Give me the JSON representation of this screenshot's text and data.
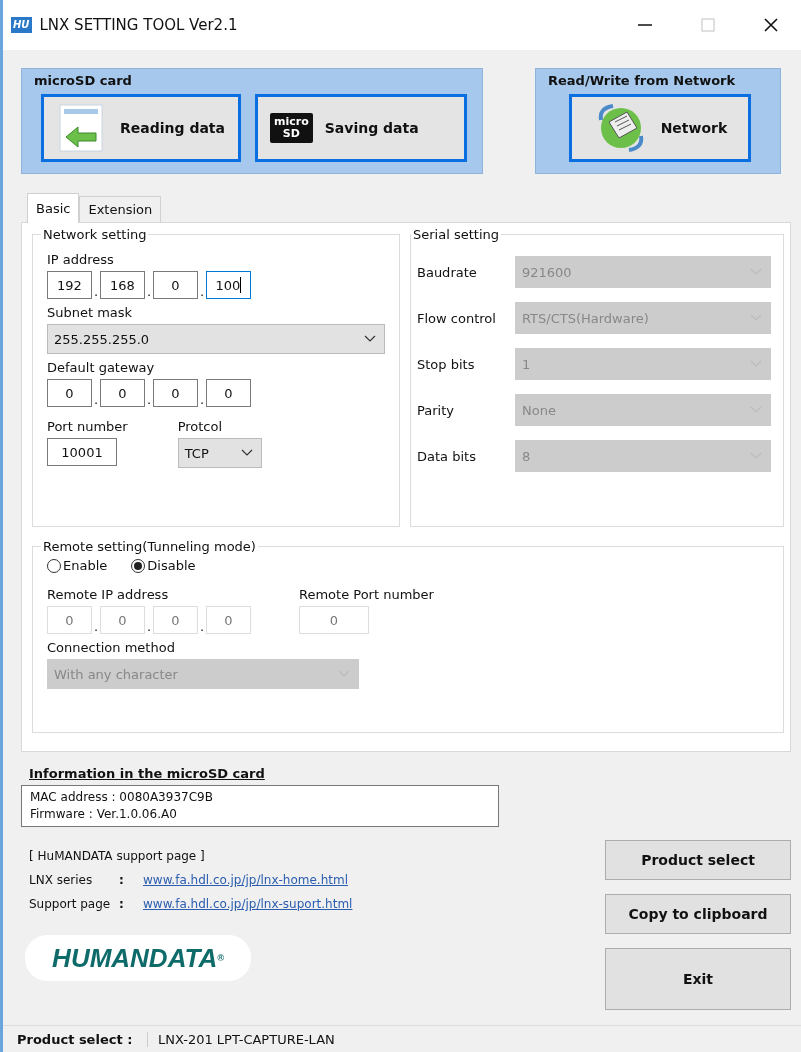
{
  "window": {
    "title": "LNX SETTING TOOL Ver2.1",
    "icon_text": "HU"
  },
  "microsd_panel": {
    "title": "microSD card",
    "buttons": [
      {
        "label": "Reading data",
        "kind": "read"
      },
      {
        "label": "Saving data",
        "kind": "sd",
        "icon_text": [
          "micro",
          "SD"
        ]
      }
    ]
  },
  "network_panel": {
    "title": "Read/Write from Network",
    "button": {
      "label": "Network",
      "kind": "network"
    }
  },
  "tabs": [
    {
      "label": "Basic",
      "selected": true
    },
    {
      "label": "Extension",
      "selected": false
    }
  ],
  "network_setting": {
    "title": "Network setting",
    "ip_label": "IP address",
    "ip": [
      {
        "value": "192",
        "focused": false
      },
      {
        "value": "168",
        "focused": false
      },
      {
        "value": "0",
        "focused": false
      },
      {
        "value": "100",
        "focused": true
      }
    ],
    "separator": ".",
    "subnet_label": "Subnet mask",
    "subnet": "255.255.255.0",
    "gateway_label": "Default gateway",
    "gateway": [
      "0",
      "0",
      "0",
      "0"
    ],
    "port_label": "Port number",
    "port": "10001",
    "protocol_label": "Protcol",
    "protocol": "TCP"
  },
  "serial_setting": {
    "title": "Serial setting",
    "rows": [
      {
        "label": "Baudrate",
        "value": "921600",
        "disabled": true
      },
      {
        "label": "Flow control",
        "value": "RTS/CTS(Hardware)",
        "disabled": true
      },
      {
        "label": "Stop bits",
        "value": "1",
        "disabled": true
      },
      {
        "label": "Parity",
        "value": "None",
        "disabled": true
      },
      {
        "label": "Data bits",
        "value": "8",
        "disabled": true
      }
    ]
  },
  "remote_setting": {
    "title": "Remote setting(Tunneling mode)",
    "options": [
      {
        "label": "Enable",
        "selected": false
      },
      {
        "label": "Disable",
        "selected": true
      }
    ],
    "ip_label": "Remote IP address",
    "ip": [
      "0",
      "0",
      "0",
      "0"
    ],
    "separator": ".",
    "port_label": "Remote Port number",
    "port": "0",
    "method_label": "Connection method",
    "method": "With any character",
    "disabled": true
  },
  "info": {
    "title": "Information in the microSD card",
    "lines": [
      "MAC address : 0080A3937C9B",
      "Firmware : Ver.1.0.06.A0"
    ]
  },
  "support": {
    "heading": "[ HuMANDATA support page ]",
    "links": [
      {
        "label": "LNX series",
        "colon": ":",
        "url": "www.fa.hdl.co.jp/jp/lnx-home.html"
      },
      {
        "label": "Support page",
        "colon": ":",
        "url": "www.fa.hdl.co.jp/jp/lnx-suport.html"
      }
    ]
  },
  "logo": {
    "text": "HUMANDATA",
    "mark": "®"
  },
  "buttons": [
    {
      "label": "Product select",
      "kind": "small"
    },
    {
      "label": "Copy to clipboard",
      "kind": "small"
    },
    {
      "label": "Exit",
      "kind": "large"
    }
  ],
  "status_bar": {
    "label": "Product select :",
    "value": "LNX-201 LPT-CAPTURE-LAN"
  }
}
